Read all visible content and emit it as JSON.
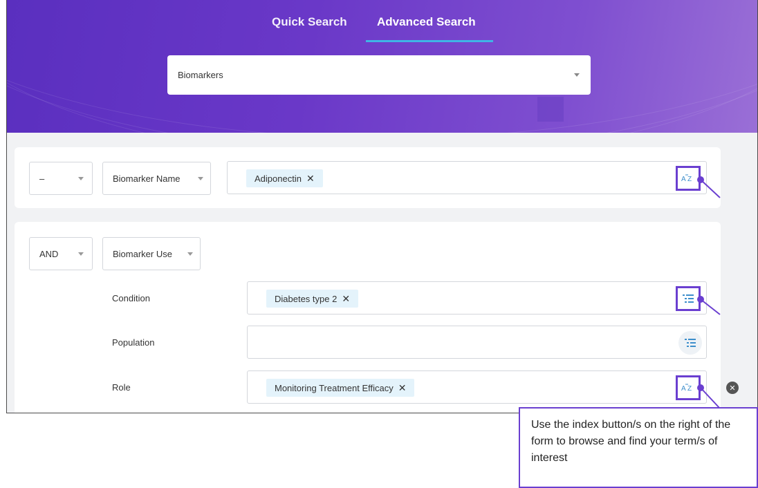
{
  "tabs": [
    {
      "label": "Quick Search",
      "active": false
    },
    {
      "label": "Advanced Search",
      "active": true
    }
  ],
  "search_type": {
    "selected": "Biomarkers"
  },
  "row1": {
    "operator": "–",
    "field": "Biomarker Name",
    "chips": [
      "Adiponectin"
    ],
    "index_icon": "az-index-icon"
  },
  "row2": {
    "operator": "AND",
    "field": "Biomarker Use",
    "sub": [
      {
        "label": "Condition",
        "chip": "Diabetes type 2",
        "index_icon": "tree-index-icon"
      },
      {
        "label": "Population",
        "chip": "",
        "index_icon": "tree-index-icon"
      },
      {
        "label": "Role",
        "chip": "Monitoring Treatment Efficacy",
        "index_icon": "az-index-icon"
      }
    ]
  },
  "remove_glyph": "✕",
  "callout": {
    "text": "Use the index button/s on the right of the form to browse and find your term/s of interest"
  },
  "colors": {
    "accent": "#6a3fd0",
    "tab_underline": "#3fb5e6",
    "chip_bg": "#e4f3fb",
    "icon_blue": "#3c8ecb"
  }
}
